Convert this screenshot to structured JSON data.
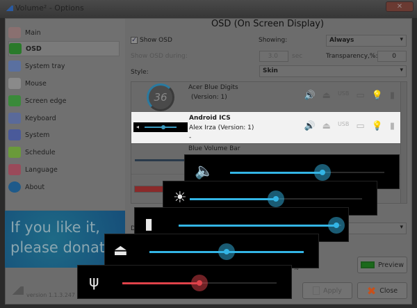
{
  "window": {
    "title": "Volume² - Options",
    "close": "✕"
  },
  "sidebar": {
    "items": [
      {
        "label": "Main",
        "icon": "wrench-gear-icon",
        "color": "#8a7070"
      },
      {
        "label": "OSD",
        "icon": "osd-icon",
        "color": "#2a7a2a"
      },
      {
        "label": "System tray",
        "icon": "system-tray-icon",
        "color": "#5a70a0"
      },
      {
        "label": "Mouse",
        "icon": "mouse-icon",
        "color": "#8a8a8a"
      },
      {
        "label": "Screen edge",
        "icon": "screen-edge-icon",
        "color": "#3a8a3a"
      },
      {
        "label": "Keyboard",
        "icon": "keyboard-icon",
        "color": "#5a6a9a"
      },
      {
        "label": "System",
        "icon": "system-icon",
        "color": "#4a5a9a"
      },
      {
        "label": "Schedule",
        "icon": "calendar-icon",
        "color": "#6a9a3a"
      },
      {
        "label": "Language",
        "icon": "language-icon",
        "color": "#9a4a5a"
      },
      {
        "label": "About",
        "icon": "info-icon",
        "color": "#1e5a8a"
      }
    ],
    "selected": "OSD"
  },
  "donate": {
    "line1": "If you like it,",
    "line2": "please donate"
  },
  "version": "version 1.1.3.247",
  "main": {
    "heading": "OSD (On Screen Display)",
    "show_osd": {
      "label": "Show OSD",
      "checked": true
    },
    "showing": {
      "label": "Showing:",
      "value": "Always"
    },
    "duration": {
      "label": "Show OSD during:",
      "value": "3.0",
      "unit": "sec"
    },
    "transparency": {
      "label": "Transparency,%:",
      "value": "0"
    },
    "style": {
      "label": "Style:",
      "value": "Skin"
    },
    "skins": [
      {
        "name": "Acer Blue Digits",
        "author": "",
        "version": "(Version: 1)",
        "preview": "36"
      },
      {
        "name": "Android ICS",
        "author": "Alex Irza (Version: 1)",
        "version": "-",
        "selected": true
      },
      {
        "name": "Blue Volume Bar"
      }
    ],
    "row_icons": [
      "🔊",
      "⏏",
      "USB",
      "▭",
      "💡",
      "▮"
    ],
    "lower_label": "D",
    "preview": "Preview",
    "apply": "Apply",
    "close": "Close",
    "stray": "%"
  },
  "osd_popups": [
    {
      "icon": "speaker-icon",
      "glyph": "🔈",
      "value": 0.6,
      "color": "#33b5e5"
    },
    {
      "icon": "brightness-icon",
      "glyph": "☀",
      "value": 0.5,
      "color": "#33b5e5"
    },
    {
      "icon": "battery-icon",
      "glyph": "▮",
      "value": 0.97,
      "color": "#33b5e5"
    },
    {
      "icon": "eject-icon",
      "glyph": "⏏",
      "value": 0.5,
      "color": "#33b5e5"
    },
    {
      "icon": "usb-icon",
      "glyph": "ψ",
      "value": 0.5,
      "color": "#e0424a"
    }
  ]
}
